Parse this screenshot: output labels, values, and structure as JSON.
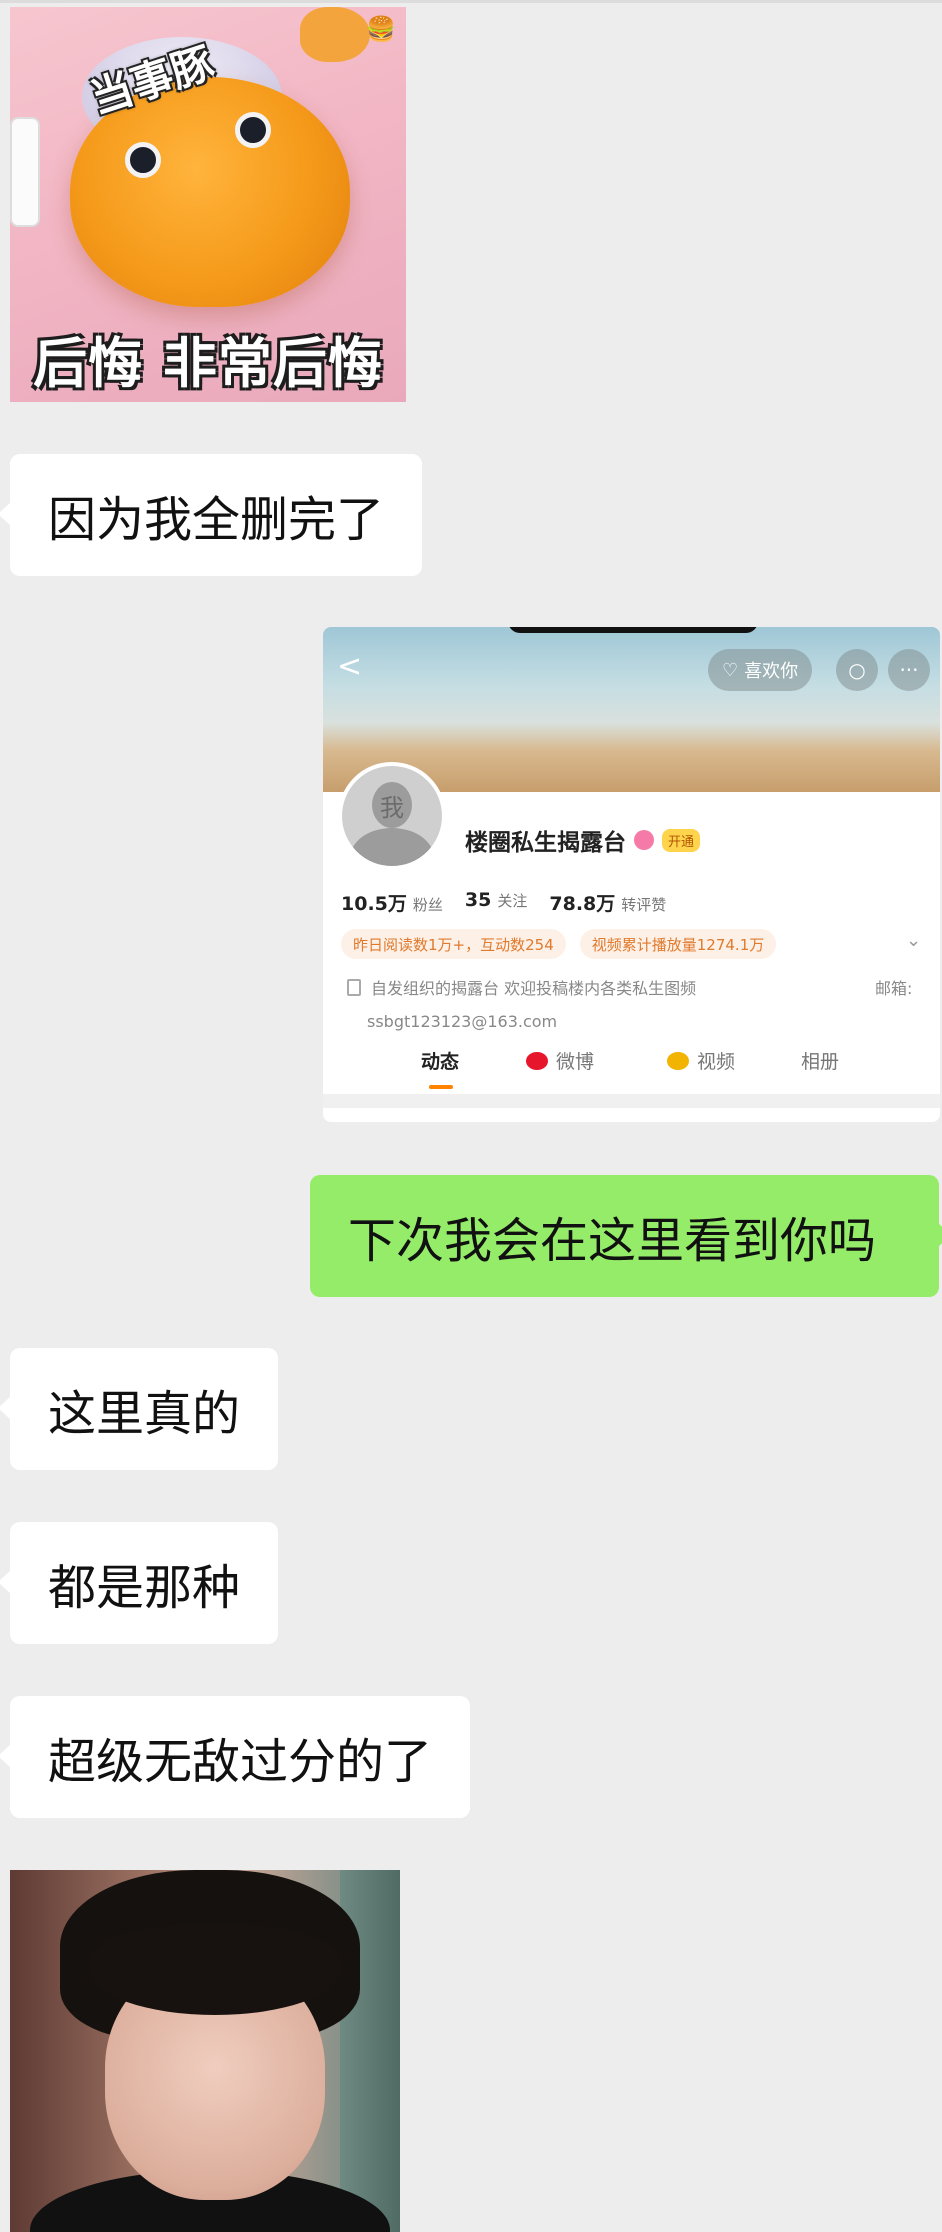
{
  "sticker": {
    "top_text": "当事豚",
    "bottom_text": "后悔 非常后悔",
    "burger_icon": "🍔"
  },
  "messages": {
    "m1": "因为我全删完了",
    "m2": "下次我会在这里看到你吗",
    "m3": "这里真的",
    "m4": "都是那种",
    "m5": "超级无敌过分的了"
  },
  "shared_profile": {
    "back_glyph": "<",
    "like_label": "喜欢你",
    "search_glyph": "○",
    "more_glyph": "···",
    "avatar_text": "我",
    "name": "楼圈私生揭露台",
    "vip_label": "开通",
    "followers_value": "10.5万",
    "followers_label": "粉丝",
    "following_value": "35",
    "following_label": "关注",
    "reposts_value": "78.8万",
    "reposts_label": "转评赞",
    "tag1": "昨日阅读数1万+，互动数254",
    "tag2": "视频累计播放量1274.1万",
    "bio_line1": "自发组织的揭露台 欢迎投稿楼内各类私生图频",
    "email_label": "邮箱:",
    "bio_line2": "ssbgt123123@163.com",
    "tabs": [
      "动态",
      "微博",
      "视频",
      "相册"
    ],
    "accent_color": "#ff8200"
  },
  "colors": {
    "background": "#ededed",
    "incoming_bubble": "#ffffff",
    "outgoing_bubble": "#95ec69"
  }
}
